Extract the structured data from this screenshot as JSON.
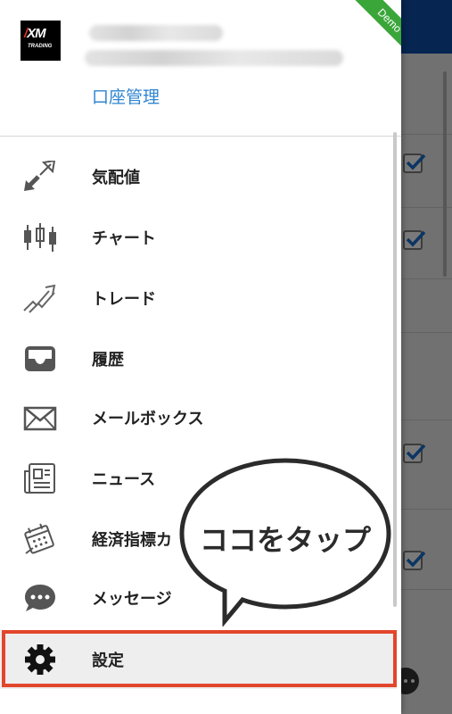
{
  "app": {
    "demo_badge": "Demo"
  },
  "account": {
    "logo_text": "XM",
    "logo_subtext": "TRADING",
    "manage_link": "口座管理"
  },
  "menu": {
    "items": [
      {
        "label": "気配値",
        "icon": "quotes-arrows-icon"
      },
      {
        "label": "チャート",
        "icon": "candlestick-chart-icon"
      },
      {
        "label": "トレード",
        "icon": "trade-trend-icon"
      },
      {
        "label": "履歴",
        "icon": "history-tray-icon"
      },
      {
        "label": "メールボックス",
        "icon": "mail-envelope-icon"
      },
      {
        "label": "ニュース",
        "icon": "news-icon"
      },
      {
        "label": "経済指標カ",
        "icon": "economic-calendar-icon"
      },
      {
        "label": "メッセージ",
        "icon": "message-bubble-icon"
      },
      {
        "label": "設定",
        "icon": "gear-icon"
      }
    ]
  },
  "callout": {
    "text": "ココをタップ"
  },
  "colors": {
    "drawer_bg": "#ffffff",
    "header_blue": "#0e4ea9",
    "link_blue": "#2f86d1",
    "demo_green": "#3aa63a",
    "highlight_red": "#e2462c"
  }
}
